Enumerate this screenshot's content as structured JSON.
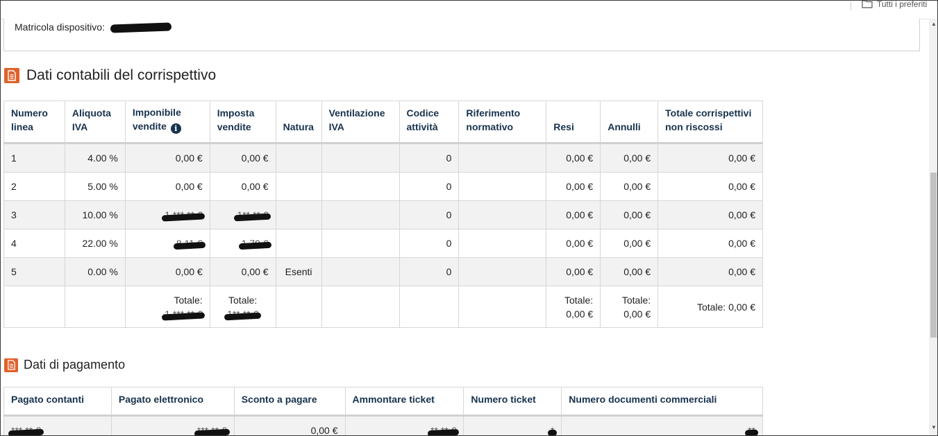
{
  "browser": {
    "favorites_label": "Tutti i preferiti"
  },
  "device": {
    "matricola_label": "Matricola dispositivo:",
    "matricola_value": "*******"
  },
  "section1": {
    "title": "Dati contabili del corrispettivo",
    "headers": [
      "Numero linea",
      "Aliquota IVA",
      "Imponibile vendite",
      "Imposta vendite",
      "Natura",
      "Ventilazione IVA",
      "Codice attività",
      "Riferimento normativo",
      "Resi",
      "Annulli",
      "Totale corrispettivi non riscossi"
    ],
    "rows": [
      {
        "num": "1",
        "aliquota": "4.00 %",
        "imponibile": "0,00 €",
        "imposta": "0,00 €",
        "natura": "",
        "ventilazione": "",
        "codice": "0",
        "riferimento": "",
        "resi": "0,00 €",
        "annulli": "0,00 €",
        "non_riscossi": "0,00 €"
      },
      {
        "num": "2",
        "aliquota": "5.00 %",
        "imponibile": "0,00 €",
        "imposta": "0,00 €",
        "natura": "",
        "ventilazione": "",
        "codice": "0",
        "riferimento": "",
        "resi": "0,00 €",
        "annulli": "0,00 €",
        "non_riscossi": "0,00 €"
      },
      {
        "num": "3",
        "aliquota": "10.00 %",
        "imponibile": "1.***,** €",
        "imposta": "1**,** €",
        "natura": "",
        "ventilazione": "",
        "codice": "0",
        "riferimento": "",
        "resi": "0,00 €",
        "annulli": "0,00 €",
        "non_riscossi": "0,00 €"
      },
      {
        "num": "4",
        "aliquota": "22.00 %",
        "imponibile": "8,11 €",
        "imposta": "1,79 €",
        "natura": "",
        "ventilazione": "",
        "codice": "0",
        "riferimento": "",
        "resi": "0,00 €",
        "annulli": "0,00 €",
        "non_riscossi": "0,00 €"
      },
      {
        "num": "5",
        "aliquota": "0.00 %",
        "imponibile": "0,00 €",
        "imposta": "0,00 €",
        "natura": "Esenti",
        "ventilazione": "",
        "codice": "0",
        "riferimento": "",
        "resi": "0,00 €",
        "annulli": "0,00 €",
        "non_riscossi": "0,00 €"
      }
    ],
    "totals": {
      "label": "Totale:",
      "imponibile": "1.***,** €",
      "imposta": "1**,** €",
      "resi": "0,00 €",
      "annulli": "0,00 €",
      "non_riscossi": "Totale: 0,00 €"
    }
  },
  "section2": {
    "title": "Dati di pagamento",
    "headers": [
      "Pagato contanti",
      "Pagato elettronico",
      "Sconto a pagare",
      "Ammontare ticket",
      "Numero ticket",
      "Numero documenti commerciali"
    ],
    "row": {
      "contanti": "***,** €",
      "elettronico": "***,** €",
      "sconto": "0,00 €",
      "ticket_ammontare": "**,** €",
      "ticket_numero": "*",
      "documenti": "**"
    }
  }
}
